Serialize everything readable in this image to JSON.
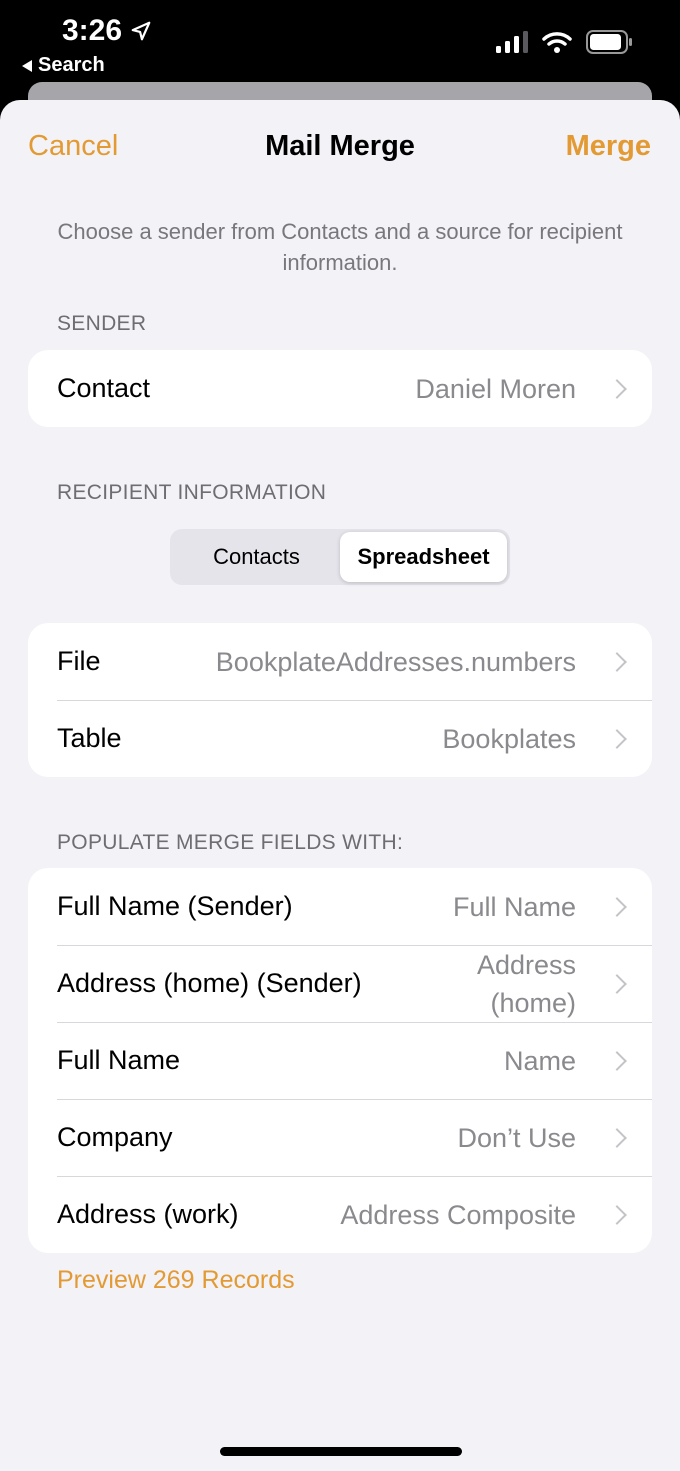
{
  "status_bar": {
    "time": "3:26",
    "back_label": "Search",
    "icons": [
      "location-arrow-icon",
      "cellular-signal-icon",
      "wifi-icon",
      "battery-icon"
    ]
  },
  "nav": {
    "cancel_label": "Cancel",
    "title": "Mail Merge",
    "merge_label": "Merge"
  },
  "intro_text": "Choose a sender from Contacts and a source for recipient information.",
  "sender": {
    "header": "SENDER",
    "contact_label": "Contact",
    "contact_value": "Daniel Moren"
  },
  "recipient": {
    "header": "RECIPIENT INFORMATION",
    "segments": [
      "Contacts",
      "Spreadsheet"
    ],
    "selected_segment": "Spreadsheet",
    "rows": [
      {
        "label": "File",
        "value": "BookplateAddresses.numbers"
      },
      {
        "label": "Table",
        "value": "Bookplates"
      }
    ]
  },
  "merge_fields": {
    "header": "POPULATE MERGE FIELDS WITH:",
    "rows": [
      {
        "label": "Full Name (Sender)",
        "value": "Full Name"
      },
      {
        "label": "Address (home) (Sender)",
        "value": "Address (home)"
      },
      {
        "label": "Full Name",
        "value": "Name"
      },
      {
        "label": "Company",
        "value": "Don’t Use"
      },
      {
        "label": "Address (work)",
        "value": "Address Composite"
      }
    ]
  },
  "preview_link": "Preview 269 Records",
  "colors": {
    "accent": "#e39a33",
    "background": "#f2f2f7",
    "secondary_text": "#8a8a8e"
  }
}
